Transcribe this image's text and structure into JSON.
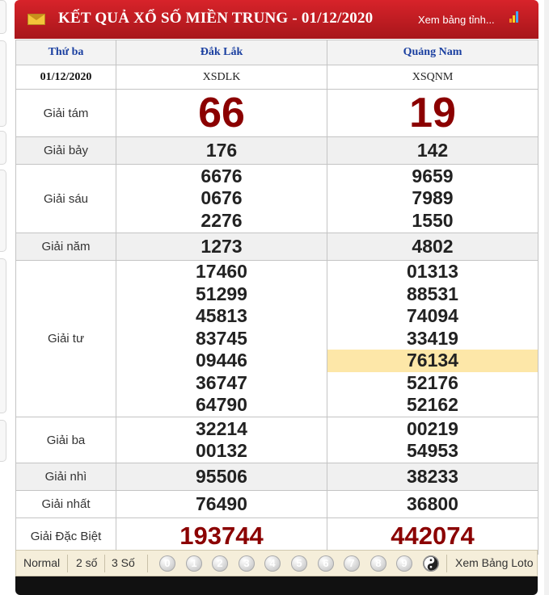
{
  "header": {
    "title": "KẾT QUẢ XỔ SỐ MIỀN TRUNG - 01/12/2020",
    "more_link": "Xem bảng tỉnh...",
    "colors": {
      "bar": "#c41e24",
      "bar_text": "#ffffff"
    },
    "icons": [
      "envelope-icon",
      "bar-chart-icon"
    ]
  },
  "table": {
    "day": "Thứ ba",
    "date": "01/12/2020",
    "provinces": [
      {
        "name": "Đắk Lắk",
        "code": "XSDLK"
      },
      {
        "name": "Quảng Nam",
        "code": "XSQNM"
      }
    ],
    "prizes": [
      {
        "label": "Giải tám",
        "values": [
          [
            "66"
          ],
          [
            "19"
          ]
        ]
      },
      {
        "label": "Giải bảy",
        "values": [
          [
            "176"
          ],
          [
            "142"
          ]
        ]
      },
      {
        "label": "Giải sáu",
        "values": [
          [
            "6676",
            "0676",
            "2276"
          ],
          [
            "9659",
            "7989",
            "1550"
          ]
        ]
      },
      {
        "label": "Giải năm",
        "values": [
          [
            "1273"
          ],
          [
            "4802"
          ]
        ]
      },
      {
        "label": "Giải tư",
        "values": [
          [
            "17460",
            "51299",
            "45813",
            "83745",
            "09446",
            "36747",
            "64790"
          ],
          [
            "01313",
            "88531",
            "74094",
            "33419",
            "76134",
            "52176",
            "52162"
          ]
        ]
      },
      {
        "label": "Giải ba",
        "values": [
          [
            "32214",
            "00132"
          ],
          [
            "00219",
            "54953"
          ]
        ]
      },
      {
        "label": "Giải nhì",
        "values": [
          [
            "95506"
          ],
          [
            "38233"
          ]
        ]
      },
      {
        "label": "Giải nhất",
        "values": [
          [
            "76490"
          ],
          [
            "36800"
          ]
        ]
      },
      {
        "label": "Giải Đặc Biệt",
        "values": [
          [
            "193744"
          ],
          [
            "442074"
          ]
        ]
      }
    ],
    "highlighted": {
      "province_index": 1,
      "prize": "Giải tư",
      "value": "76134"
    },
    "colors": {
      "highlight": "#fde7a8",
      "special_number": "#8b0000",
      "province_header": "#1a3fa0"
    }
  },
  "footer": {
    "tabs": [
      "Normal",
      "2 số",
      "3 Số"
    ],
    "digits": [
      "0",
      "1",
      "2",
      "3",
      "4",
      "5",
      "6",
      "7",
      "8",
      "9"
    ],
    "loto_link": "Xem Bảng Loto",
    "icons": [
      "yin-yang-icon"
    ]
  }
}
